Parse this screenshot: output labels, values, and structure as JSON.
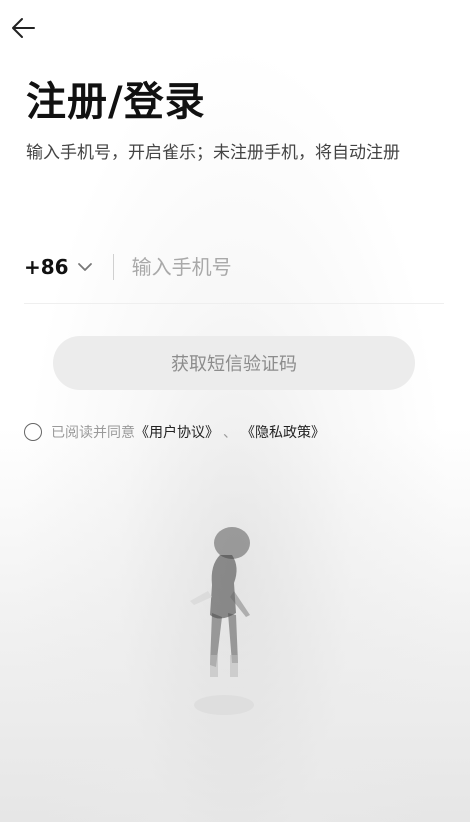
{
  "header": {
    "back_icon": "arrow-left-icon",
    "title": "注册/登录",
    "subtitle": "输入手机号，开启雀乐；未注册手机，将自动注册"
  },
  "phone": {
    "country_code": "+86",
    "chevron_icon": "chevron-down-icon",
    "value": "",
    "placeholder": "输入手机号"
  },
  "actions": {
    "get_code_label": "获取短信验证码"
  },
  "agreement": {
    "prefix": "已阅读并同意",
    "user_agreement": "《用户协议》",
    "separator": "、",
    "privacy_policy": "《隐私政策》"
  },
  "colors": {
    "text_primary": "#111111",
    "placeholder": "#a9a9a9",
    "button_bg": "#ececec",
    "button_text": "#8c8c8c"
  }
}
